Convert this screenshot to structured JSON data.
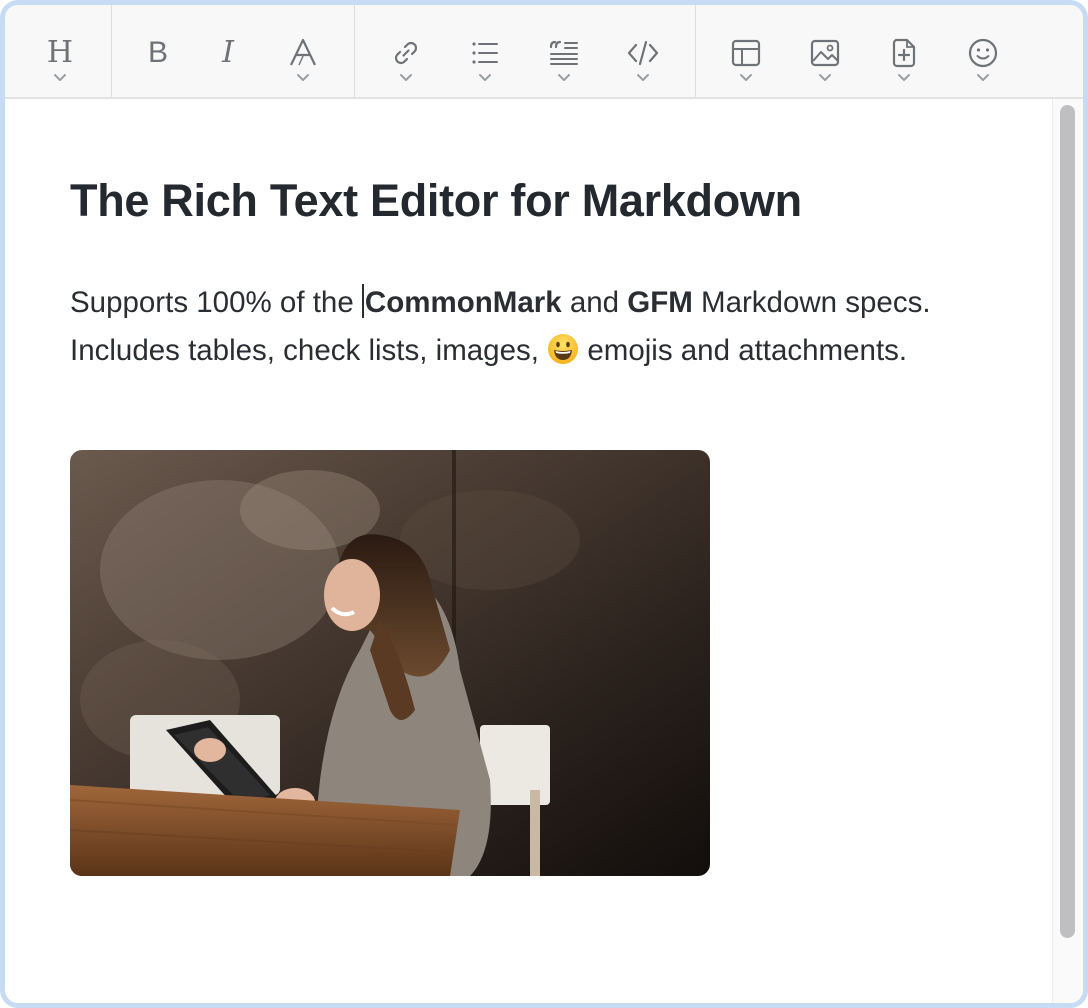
{
  "toolbar": {
    "groups": [
      [
        {
          "name": "heading-icon",
          "glyph": "H",
          "has_menu": true
        }
      ],
      [
        {
          "name": "bold-icon",
          "glyph": "B",
          "has_menu": false
        },
        {
          "name": "italic-icon",
          "glyph": "I",
          "has_menu": false
        },
        {
          "name": "text-style-icon",
          "glyph": "A",
          "has_menu": true
        }
      ],
      [
        {
          "name": "link-icon",
          "has_menu": true
        },
        {
          "name": "bulleted-list-icon",
          "has_menu": true
        },
        {
          "name": "blockquote-icon",
          "has_menu": true
        },
        {
          "name": "code-icon",
          "has_menu": true
        }
      ],
      [
        {
          "name": "table-icon",
          "has_menu": true
        },
        {
          "name": "image-icon",
          "has_menu": true
        },
        {
          "name": "insert-file-icon",
          "has_menu": true
        },
        {
          "name": "emoji-icon",
          "has_menu": true
        }
      ]
    ]
  },
  "document": {
    "title": "The Rich Text Editor for Markdown",
    "paragraph": {
      "text_before_caret": "Supports 100% of the ",
      "bold_1": "CommonMark",
      "text_2": " and ",
      "bold_2": "GFM",
      "text_3": " Markdown specs. Includes tables, check lists, images, ",
      "emoji": "grinning-face",
      "text_4": " emojis and attachments."
    },
    "image": {
      "description": "photo-woman-with-tablet"
    }
  },
  "colors": {
    "frame_border": "#c6dcf4",
    "toolbar_bg": "#f8f8f9",
    "icon": "#6f7377",
    "text": "#24292f"
  }
}
